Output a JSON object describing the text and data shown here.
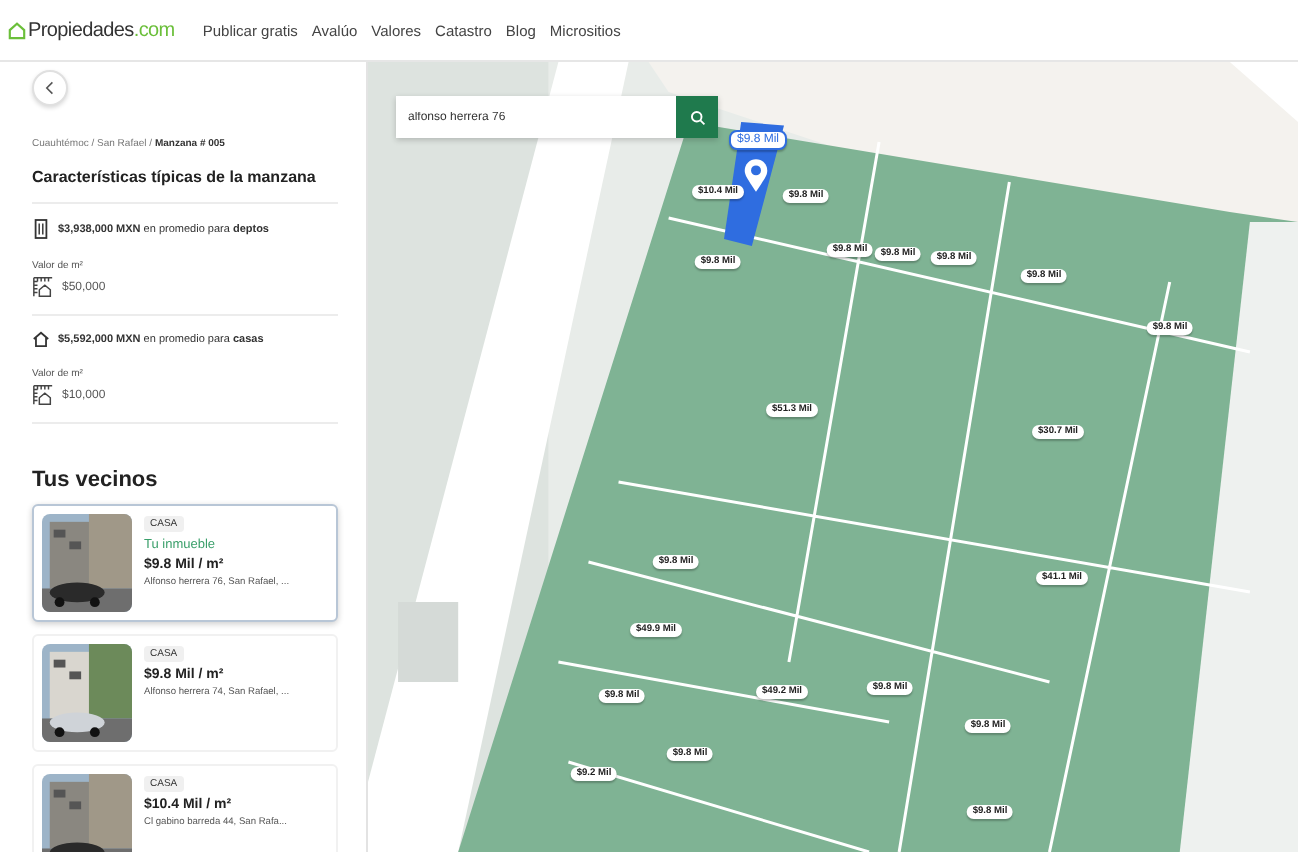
{
  "header": {
    "logo": {
      "name": "Propiedades",
      "suffix": ".com"
    },
    "nav": [
      "Publicar gratis",
      "Avalúo",
      "Valores",
      "Catastro",
      "Blog",
      "Micrositios"
    ]
  },
  "breadcrumb": "Cuauhtémoc / San Rafael / **Manzana # 005**",
  "section_title": "Características típicas de la manzana",
  "stats": [
    {
      "kind": "depto",
      "summary": "**$3,938,000 MXN** en promedio para **deptos**",
      "m2_label": "Valor de m²",
      "m2_value": "$50,000"
    },
    {
      "kind": "casa",
      "summary": "**$5,592,000 MXN** en promedio para **casas**",
      "m2_label": "Valor de m²",
      "m2_value": "$10,000"
    }
  ],
  "neighbors": {
    "title": "Tus vecinos",
    "items": [
      {
        "type": "CASA",
        "tag": "Tu inmueble",
        "price": "$9.8 Mil / m²",
        "address": "Alfonso herrera 76, San Rafael, ...",
        "selected": true
      },
      {
        "type": "CASA",
        "price": "$9.8 Mil / m²",
        "address": "Alfonso herrera 74, San Rafael, ...",
        "selected": false
      },
      {
        "type": "CASA",
        "price": "$10.4 Mil / m²",
        "address": "Cl gabino barreda 44, San Rafa...",
        "selected": false
      }
    ]
  },
  "map": {
    "search": {
      "value": "alfonso herrera 76"
    },
    "prices": [
      {
        "label": "$9.8 Mil",
        "selected": true
      },
      {
        "label": "$10.4 Mil",
        "selected": false
      },
      {
        "label": "$9.8 Mil",
        "selected": false
      },
      {
        "label": "$9.8 Mil",
        "selected": false
      },
      {
        "label": "$9.8 Mil",
        "selected": false
      },
      {
        "label": "$9.8 Mil",
        "selected": false
      },
      {
        "label": "$9.8 Mil",
        "selected": false
      },
      {
        "label": "$9.8 Mil",
        "selected": false
      },
      {
        "label": "$9.8 Mil",
        "selected": false
      },
      {
        "label": "$51.3 Mil",
        "selected": false
      },
      {
        "label": "$30.7 Mil",
        "selected": false
      },
      {
        "label": "$9.8 Mil",
        "selected": false
      },
      {
        "label": "$49.9 Mil",
        "selected": false
      },
      {
        "label": "$49.2 Mil",
        "selected": false
      },
      {
        "label": "$9.8 Mil",
        "selected": false
      },
      {
        "label": "$41.1 Mil",
        "selected": false
      },
      {
        "label": "$9.8 Mil",
        "selected": false
      },
      {
        "label": "$9.8 Mil",
        "selected": false
      },
      {
        "label": "$9.2 Mil",
        "selected": false
      },
      {
        "label": "$9.8 Mil",
        "selected": false
      },
      {
        "label": "$9.8 Mil",
        "selected": false
      }
    ]
  }
}
